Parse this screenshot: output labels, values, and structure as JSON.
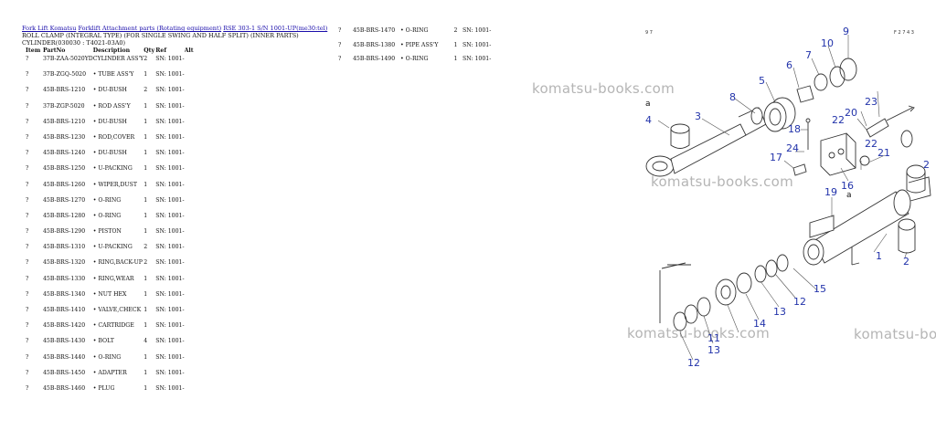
{
  "breadcrumb": {
    "items": [
      "Fork Lift Komatsu",
      "Forklift Attachment parts (Rotating equipment)",
      "RSE 303-1 S/N 1001-UP(me30:tel)"
    ]
  },
  "subtitle": "ROLL CLAMP (INTEGRAL TYPE) (FOR SINGLE SWING AND HALF SPLIT) (INNER PARTS) CYLINDER(030030 : T4021-03A0)",
  "table": {
    "headers": {
      "item": "Item",
      "partno": "PartNo",
      "description": "Description",
      "qty": "Qty",
      "ref": "Ref",
      "alt": "Alt"
    },
    "rows": [
      {
        "item": "?",
        "partno": "37B-ZAA-5020YD",
        "desc": "CYLINDER ASS'Y",
        "qty": "2",
        "ref": "SN: 1001-"
      },
      {
        "item": "?",
        "partno": "37B-ZGQ-5020",
        "desc": "• TUBE ASS'Y",
        "qty": "1",
        "ref": "SN: 1001-"
      },
      {
        "item": "?",
        "partno": "45B-BRS-1210",
        "desc": "• DU-BUSH",
        "qty": "2",
        "ref": "SN: 1001-"
      },
      {
        "item": "?",
        "partno": "37B-ZGP-5020",
        "desc": "• ROD ASS'Y",
        "qty": "1",
        "ref": "SN: 1001-"
      },
      {
        "item": "?",
        "partno": "45B-BRS-1210",
        "desc": "• DU-BUSH",
        "qty": "1",
        "ref": "SN: 1001-"
      },
      {
        "item": "?",
        "partno": "45B-BRS-1230",
        "desc": "• ROD,COVER",
        "qty": "1",
        "ref": "SN: 1001-"
      },
      {
        "item": "?",
        "partno": "45B-BRS-1240",
        "desc": "• DU-BUSH",
        "qty": "1",
        "ref": "SN: 1001-"
      },
      {
        "item": "?",
        "partno": "45B-BRS-1250",
        "desc": "• U-PACKING",
        "qty": "1",
        "ref": "SN: 1001-"
      },
      {
        "item": "?",
        "partno": "45B-BRS-1260",
        "desc": "• WIPER,DUST",
        "qty": "1",
        "ref": "SN: 1001-"
      },
      {
        "item": "?",
        "partno": "45B-BRS-1270",
        "desc": "• O-RING",
        "qty": "1",
        "ref": "SN: 1001-"
      },
      {
        "item": "?",
        "partno": "45B-BRS-1280",
        "desc": "• O-RING",
        "qty": "1",
        "ref": "SN: 1001-"
      },
      {
        "item": "?",
        "partno": "45B-BRS-1290",
        "desc": "• PISTON",
        "qty": "1",
        "ref": "SN: 1001-"
      },
      {
        "item": "?",
        "partno": "45B-BRS-1310",
        "desc": "• U-PACKING",
        "qty": "2",
        "ref": "SN: 1001-"
      },
      {
        "item": "?",
        "partno": "45B-BRS-1320",
        "desc": "• RING,BACK-UP",
        "qty": "2",
        "ref": "SN: 1001-"
      },
      {
        "item": "?",
        "partno": "45B-BRS-1330",
        "desc": "• RING,WEAR",
        "qty": "1",
        "ref": "SN: 1001-"
      },
      {
        "item": "?",
        "partno": "45B-BRS-1340",
        "desc": "• NUT HEX",
        "qty": "1",
        "ref": "SN: 1001-"
      },
      {
        "item": "?",
        "partno": "45B-BRS-1410",
        "desc": "• VALVE,CHECK",
        "qty": "1",
        "ref": "SN: 1001-"
      },
      {
        "item": "?",
        "partno": "45B-BRS-1420",
        "desc": "• CARTRIDGE",
        "qty": "1",
        "ref": "SN: 1001-"
      },
      {
        "item": "?",
        "partno": "45B-BRS-1430",
        "desc": "• BOLT",
        "qty": "4",
        "ref": "SN: 1001-"
      },
      {
        "item": "?",
        "partno": "45B-BRS-1440",
        "desc": "• O-RING",
        "qty": "1",
        "ref": "SN: 1001-"
      },
      {
        "item": "?",
        "partno": "45B-BRS-1450",
        "desc": "• ADAPTER",
        "qty": "1",
        "ref": "SN: 1001-"
      },
      {
        "item": "?",
        "partno": "45B-BRS-1460",
        "desc": "• PLUG",
        "qty": "1",
        "ref": "SN: 1001-"
      }
    ],
    "rows_right": [
      {
        "item": "?",
        "partno": "45B-BRS-1470",
        "desc": "• O-RING",
        "qty": "2",
        "ref": "SN: 1001-"
      },
      {
        "item": "?",
        "partno": "45B-BRS-1380",
        "desc": "• PIPE ASS'Y",
        "qty": "1",
        "ref": "SN: 1001-"
      },
      {
        "item": "?",
        "partno": "45B-BRS-1490",
        "desc": "• O-RING",
        "qty": "1",
        "ref": "SN: 1001-"
      }
    ]
  },
  "watermarks": [
    "komatsu-books.com",
    "komatsu-books.com",
    "komatsu-books.com",
    "komatsu-books.com"
  ],
  "diagram": {
    "corner_left": "9 7",
    "corner_right": "F 2 7 4 3",
    "letter_a": "a",
    "callouts": [
      "1",
      "2",
      "2",
      "3",
      "4",
      "5",
      "6",
      "7",
      "8",
      "9",
      "10",
      "11",
      "12",
      "12",
      "13",
      "13",
      "14",
      "15",
      "16",
      "17",
      "18",
      "19",
      "20",
      "21",
      "22",
      "22",
      "23",
      "24"
    ]
  }
}
